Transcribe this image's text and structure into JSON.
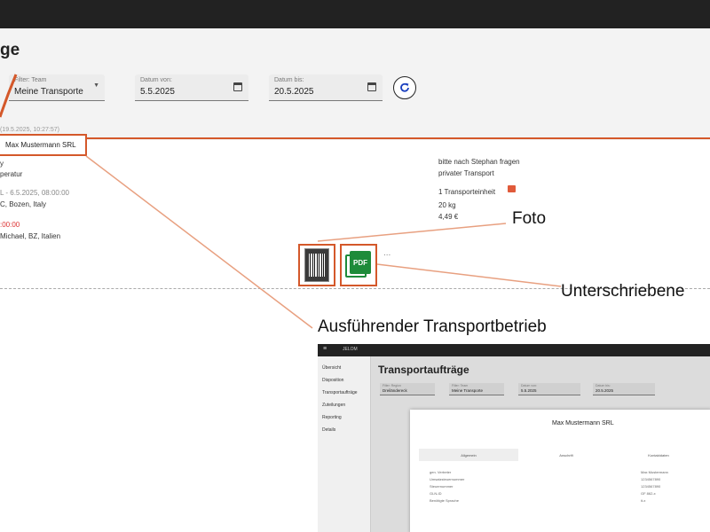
{
  "page": {
    "title": "ge"
  },
  "filters": {
    "team": {
      "label": "Filter: Team",
      "value": "Meine Transporte"
    },
    "date_from": {
      "label": "Datum von:",
      "value": "5.5.2025"
    },
    "date_to": {
      "label": "Datum bis:",
      "value": "20.5.2025"
    }
  },
  "order": {
    "header": "(19.5.2025, 10:27:57)",
    "company": "Max Mustermann SRL",
    "left_lines": [
      {
        "text": "y",
        "style": "normal"
      },
      {
        "text": "peratur",
        "style": "normal"
      },
      {
        "text": "L - 6.5.2025, 08:00:00",
        "style": "grey"
      },
      {
        "text": "C, Bozen, Italy",
        "style": "normal"
      },
      {
        "text": ":00:00",
        "style": "red"
      },
      {
        "text": "Michael, BZ, Italien",
        "style": "normal"
      }
    ],
    "note_1": "bitte nach Stephan fragen",
    "note_2": "privater Transport",
    "units": "1 Transporteinheit",
    "weight": "20 kg",
    "price": "4,49 €",
    "more": "..."
  },
  "callouts": {
    "photo": "Foto",
    "signed": "Unterschriebene",
    "carrier": "Ausführender Transportbetrieb"
  },
  "embedded": {
    "logo": "JELOM",
    "menu_icon": "≡",
    "nav": [
      "Übersicht",
      "Disposition",
      "Transportaufträge",
      "Zuteilungen",
      "Reporting",
      "Details"
    ],
    "title": "Transportaufträge",
    "filters": [
      {
        "label": "Filter: Region",
        "value": "Dreiländereck"
      },
      {
        "label": "Filter: Team",
        "value": "Meine Transporte"
      },
      {
        "label": "Datum von:",
        "value": "5.5.2025"
      },
      {
        "label": "Datum bis:",
        "value": "20.5.2025"
      }
    ],
    "dialog_title": "Max Mustermann SRL",
    "tabs": [
      "Allgemein",
      "Anschrift",
      "Kontaktdaten"
    ],
    "kv_labels": [
      "gen. Vertreter",
      "Umsatzsteuernummer",
      "Steuernummer",
      "GLN-ID",
      "Benötigte Sprache"
    ],
    "kv_values": [
      "Max Mustermann",
      "1234567890",
      "1234567890",
      "GF 862-x",
      "it-x"
    ]
  },
  "colors": {
    "accent": "#d4582a",
    "pdf_green": "#1e8b3a",
    "refresh_blue": "#1a3fbf"
  }
}
